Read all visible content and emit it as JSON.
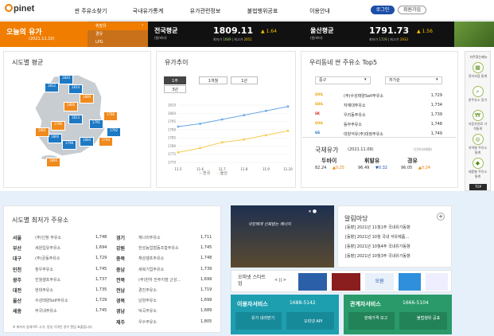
{
  "header": {
    "logo": "pinet",
    "nav": [
      "싼 주유소찾기",
      "국내유가통계",
      "유가관련정보",
      "불법행위공표",
      "이용안내"
    ],
    "login": "로그인",
    "join": "회원가입"
  },
  "today": {
    "title": "오늘의 유가",
    "date": "(2021.11.10)",
    "fuels": [
      "휘발유",
      "경유",
      "LPG"
    ]
  },
  "national": {
    "label": "전국평균",
    "unit": "(원/리터)",
    "value": "1809.11",
    "change": "▲ 1.64",
    "min_label": "최저가",
    "min": "1689",
    "max_label": "최고가",
    "max": "2651"
  },
  "ulsan": {
    "label": "울산평균",
    "unit": "(원/리터)",
    "value": "1791.73",
    "change": "▲ 1.56",
    "min_label": "최저가",
    "min": "1729",
    "max_label": "최고가",
    "max": "1933"
  },
  "regional": {
    "title": "시도별 평균",
    "prices": [
      "1820",
      "1812",
      "1814",
      "1809",
      "1806",
      "1813",
      "1796",
      "1791",
      "1786",
      "1792",
      "1794",
      "1804",
      "1800",
      "1801",
      "1798",
      "1800"
    ]
  },
  "trend": {
    "title": "유가추이",
    "tabs": [
      "1주",
      "1개월",
      "1년",
      "3년"
    ],
    "legend": [
      "전국",
      "울산"
    ]
  },
  "chart_data": {
    "type": "line",
    "categories": [
      "11.5",
      "11.6",
      "11.7",
      "11.8",
      "11.9",
      "11.10"
    ],
    "series": [
      {
        "name": "전국",
        "values": [
          1795,
          1797,
          1800,
          1803,
          1806,
          1809
        ]
      },
      {
        "name": "울산",
        "values": [
          1777,
          1780,
          1784,
          1786,
          1789,
          1792
        ]
      }
    ],
    "ylim": [
      1770,
      1810
    ],
    "yticks": [
      "1810",
      "1800",
      "1795",
      "1790",
      "1785",
      "1780",
      "1775",
      "1770"
    ]
  },
  "top5": {
    "title": "우리동네 싼 주유소 Top5",
    "sel1": "중구",
    "sel2": "저가순",
    "rows": [
      {
        "brand": "SOIL",
        "name": "(주)수성태양Self주유소",
        "price": "1,729"
      },
      {
        "brand": "SOIL",
        "name": "자재대주유소",
        "price": "1,734"
      },
      {
        "brand": "SK",
        "name": "우리동주유소",
        "price": "1,739"
      },
      {
        "brand": "SOIL",
        "name": "동부주유소",
        "price": "1,748"
      },
      {
        "brand": "GS",
        "name": "대양석유(주)대정주유소",
        "price": "1,749"
      }
    ]
  },
  "intl": {
    "title": "국제유가",
    "date": "(2021.11.09)",
    "unit": "(단위:$/배럴)",
    "items": [
      {
        "name": "두바이",
        "value": "82.24",
        "chg": "▲0.25"
      },
      {
        "name": "휘발유",
        "value": "96.49",
        "chg": "▼0.32"
      },
      {
        "name": "경유",
        "value": "96.05",
        "chg": "▲0.24"
      }
    ]
  },
  "quick": {
    "title": "자주찾는메뉴",
    "items": [
      "관리지점 통계",
      "한주유소 찾기",
      "자동차연료 가격통계",
      "지역별 주유소통계",
      "제품별 주유소통계"
    ],
    "top": "TOP"
  },
  "cheapest": {
    "title": "시도별 최저가 주유소",
    "note": "※ 최저가 업데이트 시기, 동일 가격인 경우 랜덤 표출됩니다.",
    "left": [
      {
        "region": "서울",
        "station": "(주)인창 주유소",
        "price": "1,748"
      },
      {
        "region": "부산",
        "station": "세원입유주유소",
        "price": "1,694"
      },
      {
        "region": "대구",
        "station": "(주)궁동주유소",
        "price": "1,729"
      },
      {
        "region": "인천",
        "station": "청우주유소",
        "price": "1,745"
      },
      {
        "region": "광주",
        "station": "진월셀프주유소",
        "price": "1,737"
      },
      {
        "region": "대전",
        "station": "현대주유소",
        "price": "1,735"
      },
      {
        "region": "울산",
        "station": "수성태양Self주유소",
        "price": "1,729"
      },
      {
        "region": "세종",
        "station": "부국내주유소",
        "price": "1,745"
      }
    ],
    "right": [
      {
        "region": "경기",
        "station": "재나리주유소",
        "price": "1,711"
      },
      {
        "region": "강원",
        "station": "한성농업협동조합주유소",
        "price": "1,745"
      },
      {
        "region": "충북",
        "station": "재성셀프주유소",
        "price": "1,748"
      },
      {
        "region": "충남",
        "station": "새복기업주유소",
        "price": "1,739"
      },
      {
        "region": "전북",
        "station": "(주)만하 전주지점 근성…",
        "price": "1,699"
      },
      {
        "region": "전남",
        "station": "경진주유소",
        "price": "1,719"
      },
      {
        "region": "경북",
        "station": "남양주유소",
        "price": "1,699"
      },
      {
        "region": "경남",
        "station": "덕곡주유소",
        "price": "1,689"
      },
      {
        "region": "제주",
        "station": "우수주유소",
        "price": "1,805"
      }
    ]
  },
  "banner": {
    "text": "국민에게 신뢰받는 에너지"
  },
  "notice": {
    "title": "알림마당",
    "items": [
      "[동향] 2021년 11월1주 국내유가동향",
      "[동향] 2021년 10월 국내 석유제품…",
      "[동향] 2021년 10월4주 국내유가동향",
      "[동향] 2021년 10월3주 국내유가동향"
    ]
  },
  "opinet_start": {
    "label": "오피넷 스타트업",
    "pager": "< || >",
    "tag": "오원"
  },
  "service1": {
    "title": "이용자서비스",
    "phone": "1688-5142",
    "b1": "유가 내려받기",
    "b2": "오피넷 API"
  },
  "service2": {
    "title": "관계자서비스",
    "phone": "1666-5104",
    "b1": "판매가격 보고",
    "b2": "불법행위 공표"
  }
}
